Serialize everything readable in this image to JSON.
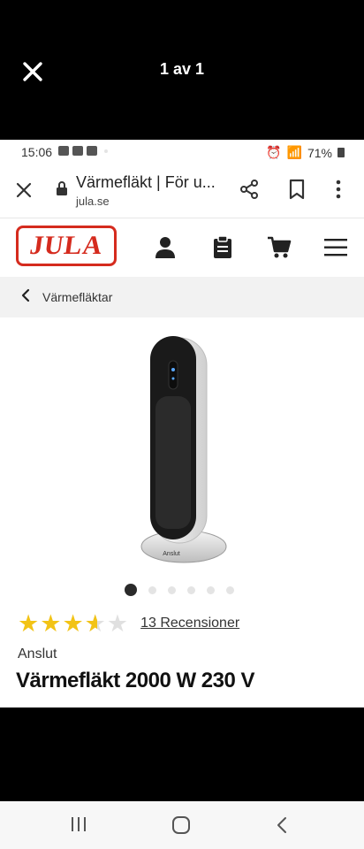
{
  "viewer": {
    "counter": "1 av 1",
    "close_icon": "close-icon"
  },
  "status_bar": {
    "time": "15:06",
    "battery": "71%"
  },
  "browser": {
    "title": "Värmefläkt | För u...",
    "domain": "jula.se"
  },
  "site": {
    "logo_text": "JULA",
    "brand_color": "#d52b1e",
    "icons": [
      "user-icon",
      "clipboard-icon",
      "cart-icon",
      "menu-icon"
    ]
  },
  "breadcrumb": {
    "label": "Värmefläktar"
  },
  "product": {
    "rating": 3.5,
    "rating_max": 5,
    "reviews_label": "13 Recensioner",
    "brand": "Anslut",
    "title": "Värmefläkt 2000 W 230 V",
    "image_count": 6,
    "active_image": 1,
    "star_color": "#f2c316"
  }
}
